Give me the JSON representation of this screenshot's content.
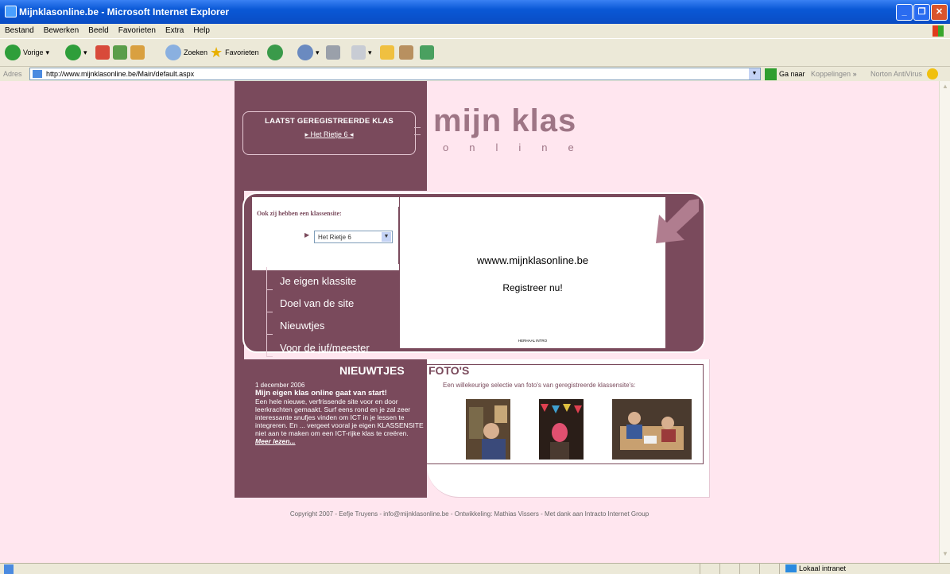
{
  "window": {
    "title": "Mijnklasonline.be - Microsoft Internet Explorer"
  },
  "menu": [
    "Bestand",
    "Bewerken",
    "Beeld",
    "Favorieten",
    "Extra",
    "Help"
  ],
  "toolbar": {
    "back": "Vorige",
    "search": "Zoeken",
    "favorites": "Favorieten"
  },
  "address": {
    "label": "Adres",
    "url": "http://www.mijnklasonline.be/Main/default.aspx",
    "go": "Ga naar",
    "links": "Koppelingen",
    "norton": "Norton AntiVirus"
  },
  "site": {
    "last_registered_title": "LAATST GEREGISTREERDE KLAS",
    "last_registered_name": "Het Rietje 6",
    "logo_top": "mijn klas",
    "logo_bottom": "online",
    "ook_title": "Ook zij hebben een klassensite:",
    "ook_select": "Het Rietje 6",
    "flash_url": "wwww.mijnklasonline.be",
    "flash_register": "Registreer nu!",
    "flash_intro": "HERHAAL INTRO",
    "nav": [
      "Je eigen klassite",
      "Doel van de site",
      "Nieuwtjes",
      "Voor de juf/meester"
    ],
    "news_header": "NIEUWTJES",
    "photos_header": "FOTO'S",
    "news_date": "1 december 2006",
    "news_title": "Mijn eigen klas online gaat van start!",
    "news_body": "Een hele nieuwe, verfrissende site voor en door leerkrachten gemaakt. Surf eens rond en je zal zeer interessante snufjes vinden om ICT in je lessen te integreren. En ... vergeet vooral je eigen KLASSENSITE niet aan te maken om een ICT-rijke klas te creëren.",
    "news_more": "Meer lezen...",
    "photos_desc": "Een willekeurige selectie van foto's van geregistreerde klassensite's:",
    "copyright": "Copyright 2007 - Eefje Truyens - info@mijnklasonline.be - Ontwikkeling: Mathias Vissers - Met dank aan Intracto Internet Group"
  },
  "status": {
    "zone": "Lokaal intranet"
  },
  "colors": {
    "brand": "#7a4a5c",
    "page_bg": "#ffe6ef",
    "logo": "#9e7585"
  }
}
